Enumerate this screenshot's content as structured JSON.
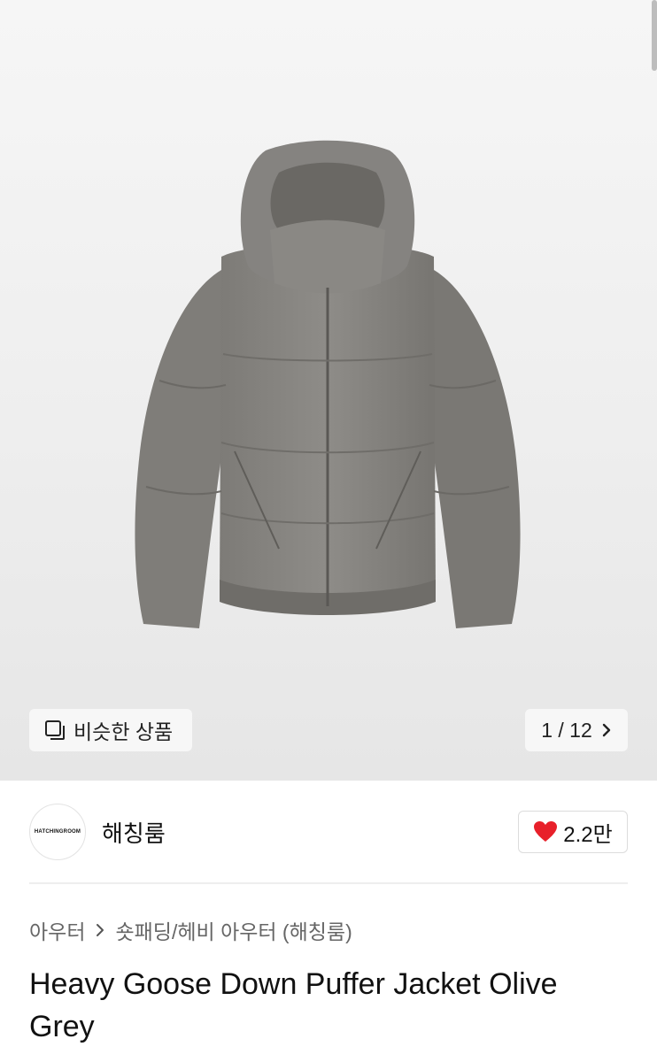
{
  "gallery": {
    "similar_label": "비슷한 상품",
    "similar_icon": "copy-icon",
    "counter": "1 / 12",
    "counter_icon": "chevron-right-icon"
  },
  "brand": {
    "logo_text": "HATCHINGROOM",
    "name": "해칭룸",
    "like_count": "2.2만",
    "like_icon": "heart-icon",
    "like_color": "#e8202a"
  },
  "breadcrumb": {
    "category": "아우터",
    "subcategory": "숏패딩/헤비 아우터 (해칭룸)"
  },
  "product": {
    "title": "Heavy Goose Down Puffer Jacket Olive Grey"
  }
}
